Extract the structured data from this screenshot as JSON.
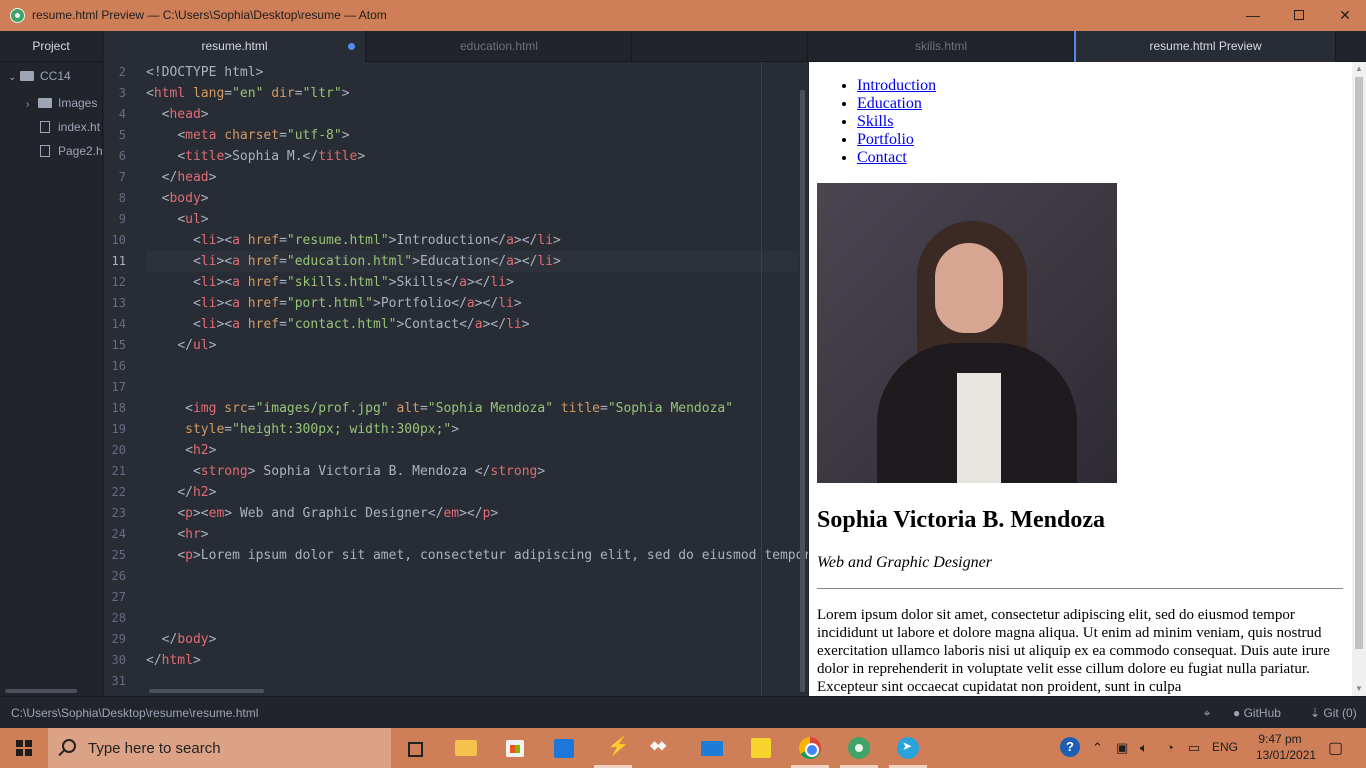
{
  "window": {
    "title": "resume.html Preview — C:\\Users\\Sophia\\Desktop\\resume — Atom",
    "min_label": "—",
    "close_label": "✕"
  },
  "tree": {
    "header": "Project",
    "items": [
      {
        "label": "CC14",
        "chev": "⌄"
      },
      {
        "label": "Images",
        "chev": "›"
      },
      {
        "label": "index.ht"
      },
      {
        "label": "Page2.h"
      }
    ]
  },
  "tabs": [
    {
      "label": "resume.html"
    },
    {
      "label": "education.html"
    },
    {
      "label": ""
    },
    {
      "label": "skills.html"
    },
    {
      "label": "resume.html Preview"
    }
  ],
  "editor": {
    "line_numbers": [
      "2",
      "3",
      "4",
      "5",
      "6",
      "7",
      "8",
      "9",
      "10",
      "11",
      "12",
      "13",
      "14",
      "15",
      "16",
      "17",
      "18",
      "19",
      "20",
      "21",
      "22",
      "23",
      "24",
      "25",
      "26",
      "27",
      "28",
      "29",
      "30",
      "31"
    ],
    "current_line": "11"
  },
  "preview": {
    "nav": [
      "Introduction",
      "Education",
      "Skills",
      "Portfolio",
      "Contact"
    ],
    "photo_alt": "Sophia Mendoza",
    "name": "Sophia Victoria B. Mendoza",
    "subtitle": "Web and Graphic Designer",
    "lorem": "Lorem ipsum dolor sit amet, consectetur adipiscing elit, sed do eiusmod tempor incididunt ut labore et dolore magna aliqua. Ut enim ad minim veniam, quis nostrud exercitation ullamco laboris nisi ut aliquip ex ea commodo consequat. Duis aute irure dolor in reprehenderit in voluptate velit esse cillum dolore eu fugiat nulla pariatur. Excepteur sint occaecat cupidatat non proident, sunt in culpa"
  },
  "statusbar": {
    "path": "C:\\Users\\Sophia\\Desktop\\resume\\resume.html",
    "github": "GitHub",
    "git": "Git (0)"
  },
  "taskbar": {
    "search_placeholder": "Type here to search",
    "lang": "ENG",
    "time": "9:47 pm",
    "date": "13/01/2021"
  }
}
